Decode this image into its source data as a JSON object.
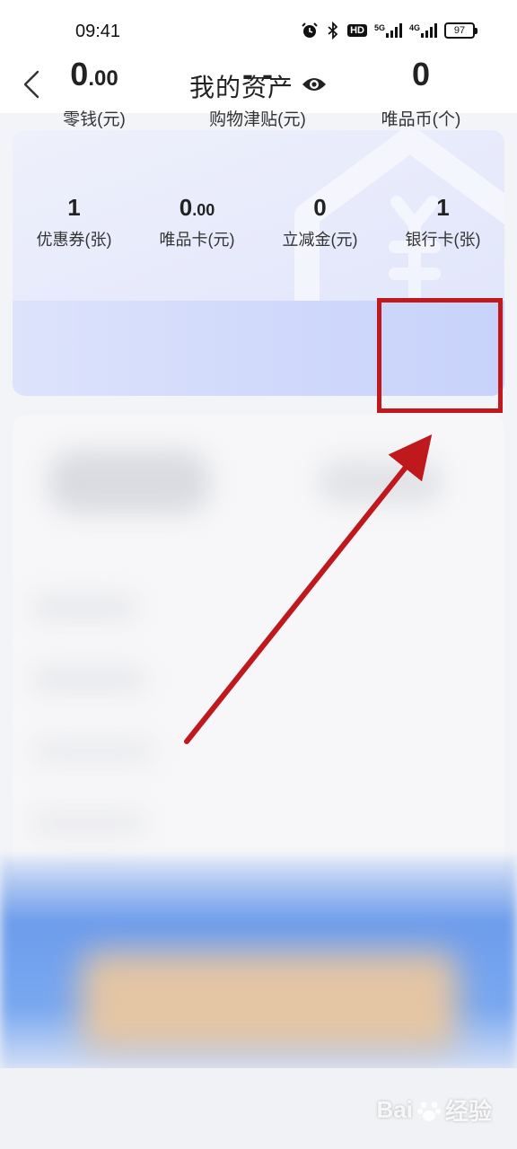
{
  "status_bar": {
    "time": "09:41",
    "hd_label": "HD",
    "net1": "5G",
    "net2": "4G",
    "battery": "97"
  },
  "nav": {
    "title": "我的资产"
  },
  "assets_top": [
    {
      "value_int": "0",
      "value_dec": ".00",
      "label": "零钱(元)"
    },
    {
      "value_int": "- -",
      "value_dec": "",
      "label": "购物津贴(元)"
    },
    {
      "value_int": "0",
      "value_dec": "",
      "label": "唯品币(个)"
    }
  ],
  "assets_bottom": [
    {
      "value_int": "1",
      "value_dec": "",
      "label": "优惠券(张)"
    },
    {
      "value_int": "0",
      "value_dec": ".00",
      "label": "唯品卡(元)"
    },
    {
      "value_int": "0",
      "value_dec": "",
      "label": "立减金(元)"
    },
    {
      "value_int": "1",
      "value_dec": "",
      "label": "银行卡(张)"
    }
  ],
  "annotation": {
    "color": "#c0191d"
  },
  "watermark": {
    "text_a": "Bai",
    "text_b": "经验"
  }
}
